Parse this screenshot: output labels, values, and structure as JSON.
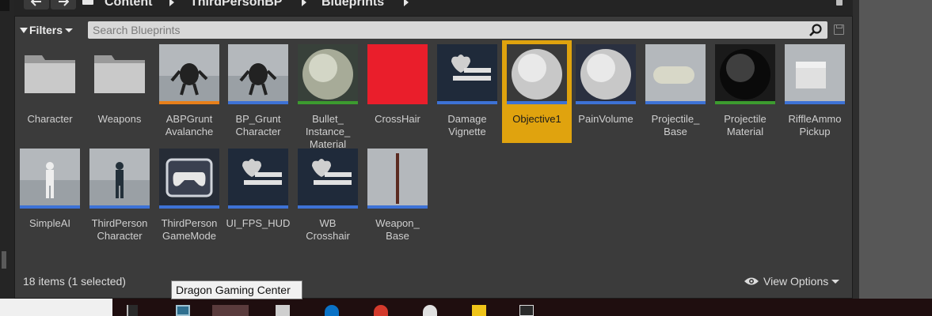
{
  "breadcrumb": {
    "items": [
      "Content",
      "ThirdPersonBP",
      "Blueprints"
    ]
  },
  "filters": {
    "label": "Filters"
  },
  "search": {
    "placeholder": "Search Blueprints"
  },
  "assets": [
    {
      "label": "Character",
      "type": "folder"
    },
    {
      "label": "Weapons",
      "type": "folder"
    },
    {
      "label": "ABPGrunt\nAvalanche",
      "type": "anim",
      "stripe": "#e8801a"
    },
    {
      "label": "BP_Grunt\nCharacter",
      "type": "blueprint",
      "stripe": "#3d72d6"
    },
    {
      "label": "Bullet_\nInstance_\nMaterial",
      "type": "material",
      "stripe": "#3c9b2f"
    },
    {
      "label": "CrossHair",
      "type": "texture",
      "color": "#ea1e2b"
    },
    {
      "label": "Damage\nVignette",
      "type": "widget",
      "stripe": "#3d72d6"
    },
    {
      "label": "Objective1",
      "type": "blueprint",
      "stripe": "#3d72d6",
      "selected": true
    },
    {
      "label": "PainVolume",
      "type": "blueprint",
      "stripe": "#3d72d6"
    },
    {
      "label": "Projectile_\nBase",
      "type": "blueprint",
      "stripe": "#3d72d6"
    },
    {
      "label": "Projectile\nMaterial",
      "type": "material",
      "stripe": "#3c9b2f"
    },
    {
      "label": "RiffleAmmo\nPickup",
      "type": "blueprint",
      "stripe": "#3d72d6"
    },
    {
      "label": "SimpleAI",
      "type": "blueprint",
      "stripe": "#3d72d6"
    },
    {
      "label": "ThirdPerson\nCharacter",
      "type": "blueprint",
      "stripe": "#3d72d6"
    },
    {
      "label": "ThirdPerson\nGameMode",
      "type": "blueprint",
      "stripe": "#3d72d6"
    },
    {
      "label": "UI_FPS_HUD",
      "type": "widget",
      "stripe": "#3d72d6"
    },
    {
      "label": "WB\nCrosshair",
      "type": "widget",
      "stripe": "#3d72d6"
    },
    {
      "label": "Weapon_\nBase",
      "type": "blueprint",
      "stripe": "#3d72d6"
    }
  ],
  "footer": {
    "count": "18 items (1 selected)",
    "view_options": "View Options"
  },
  "tooltip": {
    "text": "Dragon Gaming Center"
  }
}
